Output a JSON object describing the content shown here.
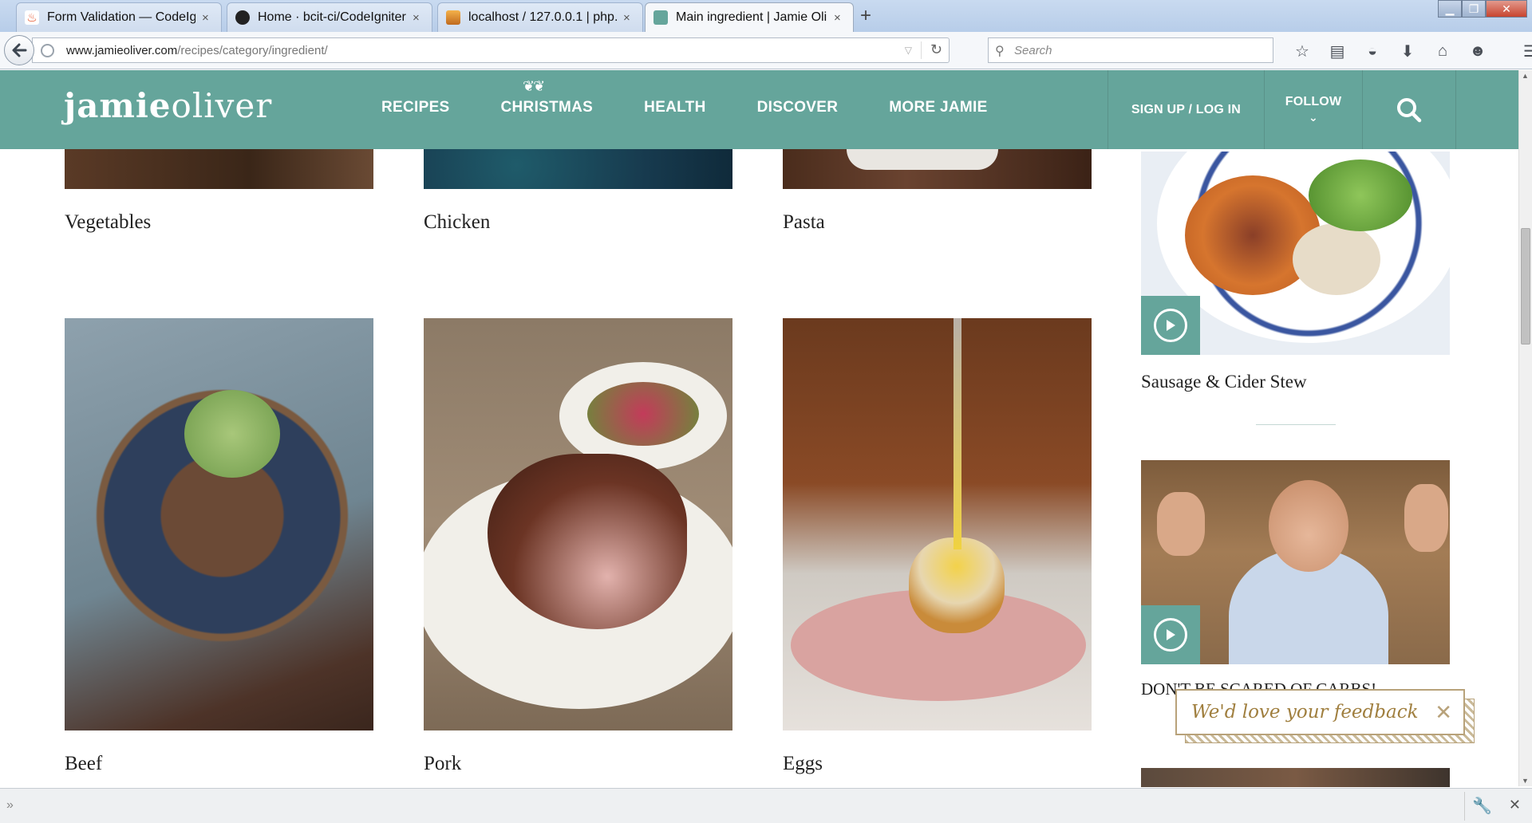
{
  "browser": {
    "tabs": [
      {
        "title": "Form Validation — CodeIg...",
        "close": "×"
      },
      {
        "title": "Home · bcit-ci/CodeIgniter...",
        "close": "×"
      },
      {
        "title": "localhost / 127.0.0.1 | php...",
        "close": "×"
      },
      {
        "title": "Main ingredient | Jamie Oli...",
        "close": "×"
      }
    ],
    "new_tab": "+",
    "url_host": "www.jamieoliver.com",
    "url_path": "/recipes/category/ingredient/",
    "search_placeholder": "Search"
  },
  "site": {
    "logo_bold": "jamie",
    "logo_light": "oliver",
    "nav": [
      "RECIPES",
      "CHRISTMAS",
      "HEALTH",
      "DISCOVER",
      "MORE JAMIE"
    ],
    "signup": "SIGN UP / LOG IN",
    "follow": "FOLLOW",
    "accent_color": "#65a59b"
  },
  "categories": [
    "Vegetables",
    "Chicken",
    "Pasta",
    "Beef",
    "Pork",
    "Eggs"
  ],
  "sidebar": {
    "video1_title": "Sausage & Cider Stew",
    "video2_title": "DON'T BE SCARED OF CARBS!"
  },
  "feedback": {
    "text": "We'd love your feedback",
    "close": "✕"
  }
}
